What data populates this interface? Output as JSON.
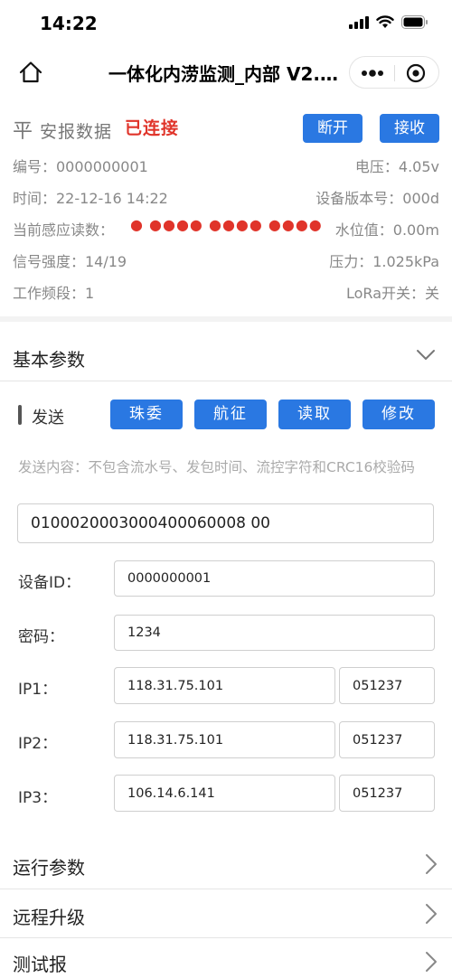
{
  "status_bar": {
    "time": "14:22"
  },
  "nav": {
    "title": "一体化内涝监测_内部 V2.…"
  },
  "header": {
    "title_first": "平",
    "title_rest": " 安报数据",
    "connection": "已连接",
    "disconnect_label": "断开",
    "receive_label": "接收"
  },
  "info": {
    "serial": "编号：0000000001",
    "voltage": "电压：4.05v",
    "time": "时间：22-12-16 14:22",
    "device_version": "设备版本号：000d",
    "sensor_label": "当前感应读数：",
    "sensor_dots": "● ●●●● ●●●● ●●●●",
    "water_level": "水位值：0.00m",
    "signal": "信号强度：14/19",
    "pressure": "压力：1.025kPa",
    "band": "工作频段：1",
    "lora": "LoRa开关：关"
  },
  "basic_params": {
    "title": "基本参数"
  },
  "send": {
    "label": "发送",
    "buttons": [
      "珠委",
      "航征",
      "读取",
      "修改"
    ],
    "hint": "发送内容：不包含流水号、发包时间、流控字符和CRC16校验码",
    "content": "0100020003000400060008 00"
  },
  "fields": {
    "device_id_label": "设备ID：",
    "device_id": "0000000001",
    "password_label": "密码：",
    "password": "1234",
    "ip1_label": "IP1：",
    "ip1": "118.31.75.101",
    "ip1_port": "051237",
    "ip2_label": "IP2：",
    "ip2": "118.31.75.101",
    "ip2_port": "051237",
    "ip3_label": "IP3：",
    "ip3": "106.14.6.141",
    "ip3_port": "051237"
  },
  "sections": {
    "run_params": "运行参数",
    "remote_upgrade": "远程升级",
    "test_report": "测试报"
  }
}
